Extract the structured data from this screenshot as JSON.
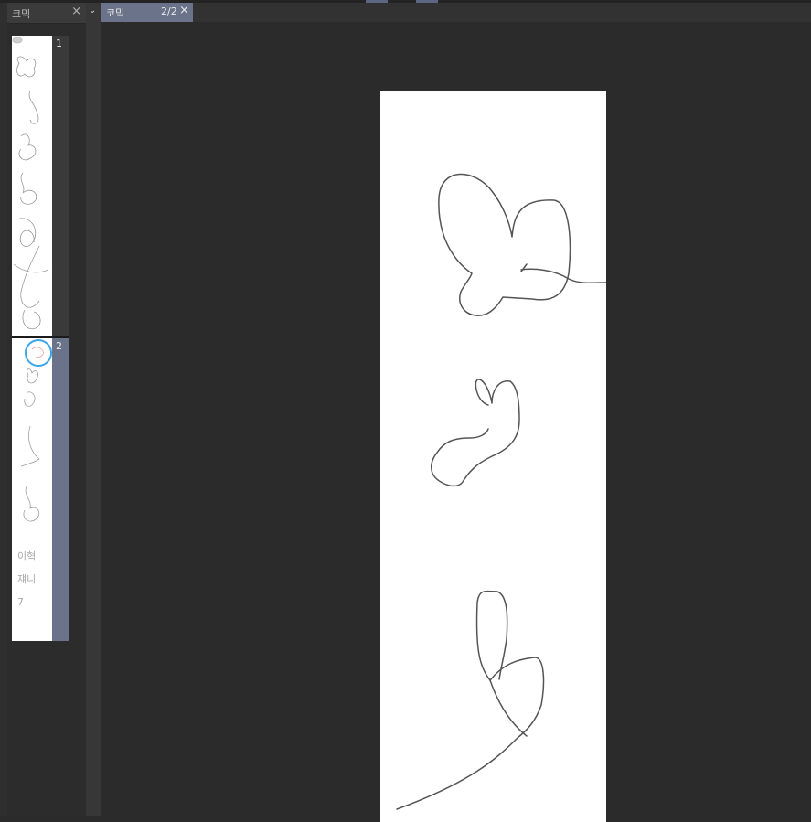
{
  "left_panel": {
    "tab_label": "코믹",
    "close_icon": "close-icon",
    "pages": [
      {
        "number": "1",
        "active": false
      },
      {
        "number": "2",
        "active": true
      }
    ],
    "page2_thumb_text": {
      "line1": "이혁",
      "line2": "쟤니",
      "line3": "7"
    }
  },
  "document": {
    "tab_label": "코믹",
    "page_indicator": "2/2",
    "close_icon": "close-icon",
    "collapse_icon": "chevron-down-icon"
  },
  "colors": {
    "background": "#2b2b2b",
    "active_tab": "#6a7389",
    "page": "#ffffff",
    "stroke": "#555555",
    "cursor_ring": "#3ea6e6"
  }
}
